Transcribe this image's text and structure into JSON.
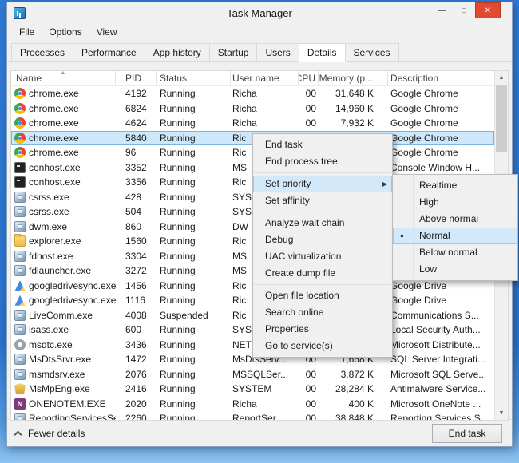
{
  "window": {
    "title": "Task Manager",
    "caption": {
      "minimize": "—",
      "maximize": "□",
      "close": "✕"
    }
  },
  "menubar": {
    "items": [
      {
        "label": "File"
      },
      {
        "label": "Options"
      },
      {
        "label": "View"
      }
    ]
  },
  "tabs": {
    "items": [
      {
        "label": "Processes",
        "active": false
      },
      {
        "label": "Performance",
        "active": false
      },
      {
        "label": "App history",
        "active": false
      },
      {
        "label": "Startup",
        "active": false
      },
      {
        "label": "Users",
        "active": false
      },
      {
        "label": "Details",
        "active": true
      },
      {
        "label": "Services",
        "active": false
      }
    ]
  },
  "table": {
    "sort_glyph": "▲",
    "columns": [
      {
        "label": "Name"
      },
      {
        "label": "PID"
      },
      {
        "label": "Status"
      },
      {
        "label": "User name"
      },
      {
        "label": "CPU"
      },
      {
        "label": "Memory (p..."
      },
      {
        "label": "Description"
      }
    ],
    "rows": [
      {
        "icon": "chrome",
        "name": "chrome.exe",
        "pid": "4192",
        "status": "Running",
        "user": "Richa",
        "cpu": "00",
        "memory": "31,648 K",
        "description": "Google Chrome",
        "selected": false
      },
      {
        "icon": "chrome",
        "name": "chrome.exe",
        "pid": "6824",
        "status": "Running",
        "user": "Richa",
        "cpu": "00",
        "memory": "14,960 K",
        "description": "Google Chrome",
        "selected": false
      },
      {
        "icon": "chrome",
        "name": "chrome.exe",
        "pid": "4624",
        "status": "Running",
        "user": "Richa",
        "cpu": "00",
        "memory": "7,932 K",
        "description": "Google Chrome",
        "selected": false
      },
      {
        "icon": "chrome",
        "name": "chrome.exe",
        "pid": "5840",
        "status": "Running",
        "user": "Ric",
        "cpu": "",
        "memory": "",
        "description": "Google Chrome",
        "selected": true
      },
      {
        "icon": "chrome",
        "name": "chrome.exe",
        "pid": "96",
        "status": "Running",
        "user": "Ric",
        "cpu": "",
        "memory": "",
        "description": "Google Chrome",
        "selected": false
      },
      {
        "icon": "console",
        "name": "conhost.exe",
        "pid": "3352",
        "status": "Running",
        "user": "MS",
        "cpu": "",
        "memory": "",
        "description": "Console Window H...",
        "selected": false
      },
      {
        "icon": "console",
        "name": "conhost.exe",
        "pid": "3356",
        "status": "Running",
        "user": "Ric",
        "cpu": "",
        "memory": "",
        "description": "",
        "selected": false
      },
      {
        "icon": "generic-exe",
        "name": "csrss.exe",
        "pid": "428",
        "status": "Running",
        "user": "SYS",
        "cpu": "",
        "memory": "",
        "description": "",
        "selected": false
      },
      {
        "icon": "generic-exe",
        "name": "csrss.exe",
        "pid": "504",
        "status": "Running",
        "user": "SYS",
        "cpu": "",
        "memory": "",
        "description": "",
        "selected": false
      },
      {
        "icon": "generic-exe",
        "name": "dwm.exe",
        "pid": "860",
        "status": "Running",
        "user": "DW",
        "cpu": "",
        "memory": "",
        "description": "",
        "selected": false
      },
      {
        "icon": "folder",
        "name": "explorer.exe",
        "pid": "1560",
        "status": "Running",
        "user": "Ric",
        "cpu": "",
        "memory": "",
        "description": "",
        "selected": false
      },
      {
        "icon": "generic-exe",
        "name": "fdhost.exe",
        "pid": "3304",
        "status": "Running",
        "user": "MS",
        "cpu": "",
        "memory": "",
        "description": "",
        "selected": false
      },
      {
        "icon": "generic-exe",
        "name": "fdlauncher.exe",
        "pid": "3272",
        "status": "Running",
        "user": "MS",
        "cpu": "",
        "memory": "",
        "description": "",
        "selected": false
      },
      {
        "icon": "google-drive",
        "name": "googledrivesync.exe",
        "pid": "1456",
        "status": "Running",
        "user": "Ric",
        "cpu": "",
        "memory": "",
        "description": "Google Drive",
        "selected": false
      },
      {
        "icon": "google-drive",
        "name": "googledrivesync.exe",
        "pid": "1116",
        "status": "Running",
        "user": "Ric",
        "cpu": "",
        "memory": "",
        "description": "Google Drive",
        "selected": false
      },
      {
        "icon": "generic-exe",
        "name": "LiveComm.exe",
        "pid": "4008",
        "status": "Suspended",
        "user": "Ric",
        "cpu": "",
        "memory": "",
        "description": "Communications S...",
        "selected": false
      },
      {
        "icon": "generic-exe",
        "name": "lsass.exe",
        "pid": "600",
        "status": "Running",
        "user": "SYS",
        "cpu": "",
        "memory": "",
        "description": "Local Security Auth...",
        "selected": false
      },
      {
        "icon": "gear",
        "name": "msdtc.exe",
        "pid": "3436",
        "status": "Running",
        "user": "NET",
        "cpu": "",
        "memory": "",
        "description": "Microsoft Distribute...",
        "selected": false
      },
      {
        "icon": "generic-exe",
        "name": "MsDtsSrvr.exe",
        "pid": "1472",
        "status": "Running",
        "user": "MsDtsServ...",
        "cpu": "00",
        "memory": "1,668 K",
        "description": "SQL Server Integrati...",
        "selected": false
      },
      {
        "icon": "generic-exe",
        "name": "msmdsrv.exe",
        "pid": "2076",
        "status": "Running",
        "user": "MSSQLSer...",
        "cpu": "00",
        "memory": "3,872 K",
        "description": "Microsoft SQL Serve...",
        "selected": false
      },
      {
        "icon": "shield",
        "name": "MsMpEng.exe",
        "pid": "2416",
        "status": "Running",
        "user": "SYSTEM",
        "cpu": "00",
        "memory": "28,284 K",
        "description": "Antimalware Service...",
        "selected": false
      },
      {
        "icon": "onenote",
        "name": "ONENOTEM.EXE",
        "pid": "2020",
        "status": "Running",
        "user": "Richa",
        "cpu": "00",
        "memory": "400 K",
        "description": "Microsoft OneNote ...",
        "selected": false
      },
      {
        "icon": "generic-exe",
        "name": "ReportingServicesSer...",
        "pid": "2260",
        "status": "Running",
        "user": "ReportSer...",
        "cpu": "00",
        "memory": "38,848 K",
        "description": "Reporting Services S...",
        "selected": false
      }
    ]
  },
  "scrollbar": {
    "up_glyph": "▲",
    "down_glyph": "▼"
  },
  "context_menu": {
    "submenu_arrow_glyph": "▶",
    "items": [
      {
        "label": "End task"
      },
      {
        "label": "End process tree"
      },
      {
        "sep": true
      },
      {
        "label": "Set priority",
        "highlighted": true,
        "submenu": true
      },
      {
        "label": "Set affinity"
      },
      {
        "sep": true
      },
      {
        "label": "Analyze wait chain"
      },
      {
        "label": "Debug"
      },
      {
        "label": "UAC virtualization"
      },
      {
        "label": "Create dump file"
      },
      {
        "sep": true
      },
      {
        "label": "Open file location"
      },
      {
        "label": "Search online"
      },
      {
        "label": "Properties"
      },
      {
        "label": "Go to service(s)"
      }
    ]
  },
  "submenu": {
    "radio_glyph": "●",
    "items": [
      {
        "label": "Realtime"
      },
      {
        "label": "High"
      },
      {
        "label": "Above normal"
      },
      {
        "label": "Normal",
        "selected": true,
        "highlighted": true
      },
      {
        "label": "Below normal"
      },
      {
        "label": "Low"
      }
    ]
  },
  "footer": {
    "fewer_details": "Fewer details",
    "end_task": "End task"
  }
}
